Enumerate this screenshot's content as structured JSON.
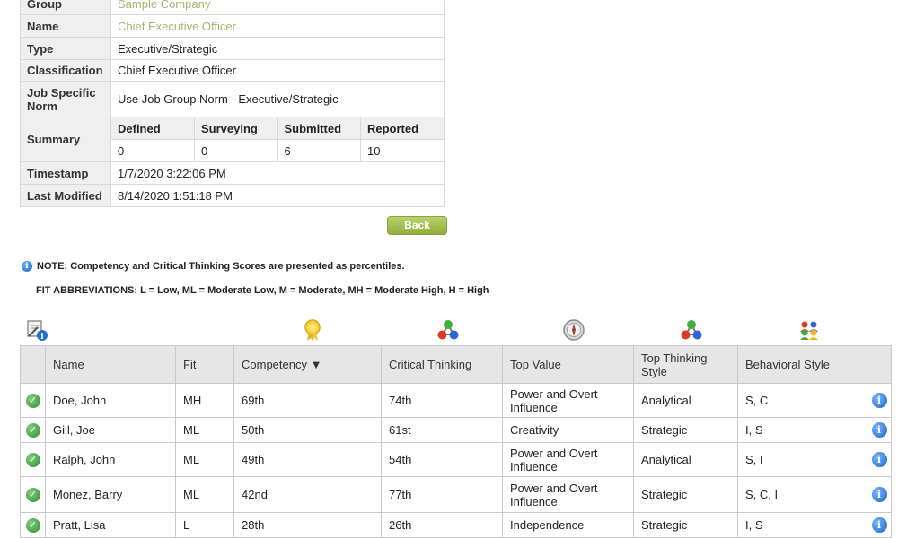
{
  "info": {
    "group_label": "Group",
    "group_value": "Sample Company",
    "name_label": "Name",
    "name_value": "Chief Executive Officer",
    "type_label": "Type",
    "type_value": "Executive/Strategic",
    "classification_label": "Classification",
    "classification_value": "Chief Executive Officer",
    "norm_label": "Job Specific Norm",
    "norm_value": "Use Job Group Norm - Executive/Strategic",
    "summary_label": "Summary",
    "summary": {
      "headers": [
        "Defined",
        "Surveying",
        "Submitted",
        "Reported"
      ],
      "values": [
        "0",
        "0",
        "6",
        "10"
      ]
    },
    "timestamp_label": "Timestamp",
    "timestamp_value": "1/7/2020 3:22:06 PM",
    "modified_label": "Last Modified",
    "modified_value": "8/14/2020 1:51:18 PM"
  },
  "back_label": "Back",
  "note_text": "NOTE: Competency and Critical Thinking Scores are presented as percentiles.",
  "fit_abbreviations": "FIT ABBREVIATIONS: L = Low, ML = Moderate Low, M = Moderate, MH = Moderate High, H = High",
  "header_icons": [
    "report-info-icon",
    "award-ribbon-icon",
    "critical-thinking-icon",
    "compass-icon",
    "thinking-style-icon",
    "behavioral-style-icon"
  ],
  "colors": {
    "accent_green": "#9bb94a",
    "header_bg": "#e6e6e6",
    "link_olive": "#a9b26f",
    "info_blue": "#1a64c8"
  },
  "results": {
    "columns": [
      "Name",
      "Fit",
      "Competency ▼",
      "Critical Thinking",
      "Top Value",
      "Top Thinking Style",
      "Behavioral Style"
    ],
    "rows": [
      {
        "name": "Doe, John",
        "fit": "MH",
        "competency": "69th",
        "critical": "74th",
        "value": "Power and Overt Influence",
        "thinking": "Analytical",
        "behavioral": "S, C"
      },
      {
        "name": "Gill, Joe",
        "fit": "ML",
        "competency": "50th",
        "critical": "61st",
        "value": "Creativity",
        "thinking": "Strategic",
        "behavioral": "I, S"
      },
      {
        "name": "Ralph, John",
        "fit": "ML",
        "competency": "49th",
        "critical": "54th",
        "value": "Power and Overt Influence",
        "thinking": "Analytical",
        "behavioral": "S, I"
      },
      {
        "name": "Monez, Barry",
        "fit": "ML",
        "competency": "42nd",
        "critical": "77th",
        "value": "Power and Overt Influence",
        "thinking": "Strategic",
        "behavioral": "S, C, I"
      },
      {
        "name": "Pratt, Lisa",
        "fit": "L",
        "competency": "28th",
        "critical": "26th",
        "value": "Independence",
        "thinking": "Strategic",
        "behavioral": "I, S"
      }
    ]
  }
}
